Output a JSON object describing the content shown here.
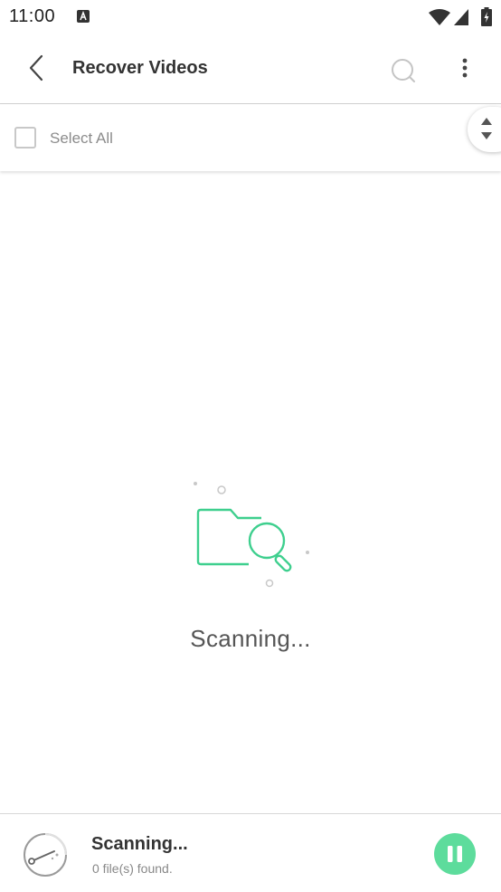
{
  "status_bar": {
    "time": "11:00"
  },
  "app_bar": {
    "title": "Recover Videos"
  },
  "select_bar": {
    "select_all_label": "Select All",
    "checked": false
  },
  "main": {
    "status_text": "Scanning..."
  },
  "bottom_bar": {
    "title": "Scanning...",
    "subtitle": "0 file(s) found."
  },
  "colors": {
    "accent": "#5ddc9c",
    "illustration": "#3ecf8e"
  },
  "icons": {
    "back": "chevron-left-icon",
    "search": "search-icon",
    "more": "more-vertical-icon",
    "sort": "sort-icon",
    "folder_search": "folder-search-icon",
    "radar": "radar-icon",
    "pause": "pause-icon"
  }
}
